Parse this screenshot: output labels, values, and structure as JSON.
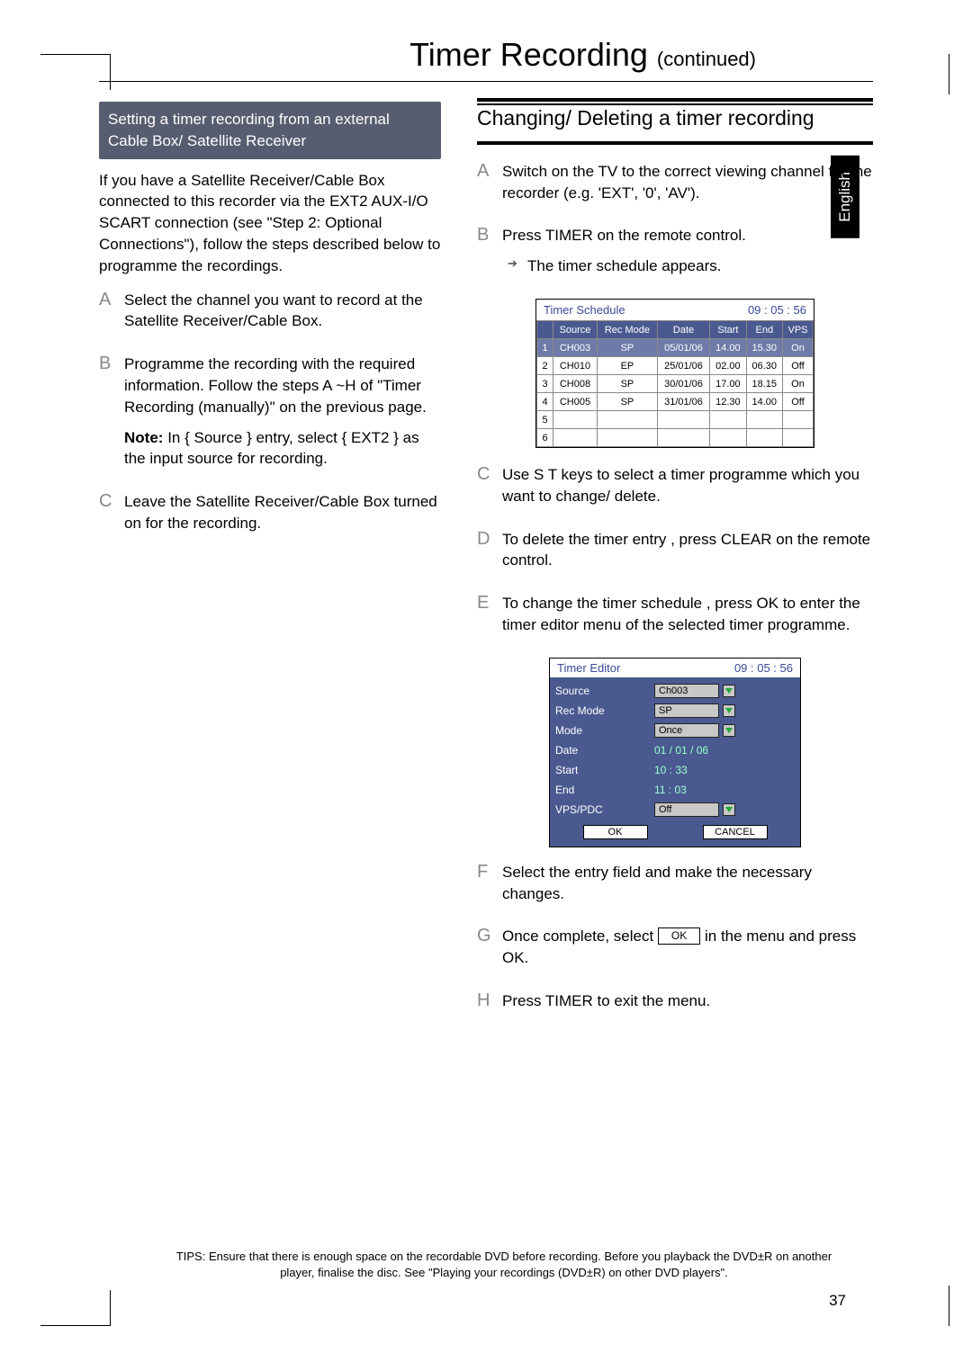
{
  "lang_tab": "English",
  "page_title": "Timer Recording",
  "page_title_cont": "(continued)",
  "page_number": "37",
  "left": {
    "header": "Setting a timer recording from an external Cable Box/ Satellite Receiver",
    "intro": "If you have a Satellite Receiver/Cable Box connected to this recorder via the EXT2 AUX-I/O SCART connection (see \"Step 2: Optional Connections\"), follow the steps described below to programme the recordings.",
    "A": "Select the channel you want to record at the Satellite Receiver/Cable Box.",
    "B": "Programme the recording with the required information. Follow the steps A ~H of \"Timer Recording (manually)\" on the previous page.",
    "B_note_label": "Note:",
    "B_note": "In { Source } entry, select { EXT2 } as the input source for recording.",
    "C": "Leave the Satellite Receiver/Cable Box turned on for the recording."
  },
  "right": {
    "header": "Changing/ Deleting a timer recording",
    "A": "Switch on the TV to the correct viewing channel for the recorder (e.g. 'EXT', '0', 'AV').",
    "B": "Press TIMER on the remote control.",
    "B_sub": "The timer schedule appears.",
    "C": "Use  S T  keys to select a timer programme which you want to change/ delete.",
    "D": "To delete the timer entry  , press CLEAR on the remote control.",
    "E": "To change the timer schedule  , press OK to enter the timer editor menu of the selected timer programme.",
    "F": "Select the entry field and make the necessary changes.",
    "G_pre": "Once complete, select ",
    "G_btn": "OK",
    "G_post": " in the menu and press OK.",
    "H": "Press TIMER to exit the menu."
  },
  "schedule": {
    "title": "Timer Schedule",
    "clock": "09 : 05 : 56",
    "headers": [
      "",
      "Source",
      "Rec Mode",
      "Date",
      "Start",
      "End",
      "VPS"
    ],
    "rows": [
      [
        "1",
        "CH003",
        "SP",
        "05/01/06",
        "14.00",
        "15.30",
        "On"
      ],
      [
        "2",
        "CH010",
        "EP",
        "25/01/06",
        "02.00",
        "06.30",
        "Off"
      ],
      [
        "3",
        "CH008",
        "SP",
        "30/01/06",
        "17.00",
        "18.15",
        "On"
      ],
      [
        "4",
        "CH005",
        "SP",
        "31/01/06",
        "12.30",
        "14.00",
        "Off"
      ],
      [
        "5",
        "",
        "",
        "",
        "",
        "",
        ""
      ],
      [
        "6",
        "",
        "",
        "",
        "",
        "",
        ""
      ]
    ]
  },
  "editor": {
    "title": "Timer Editor",
    "clock": "09 : 05 : 56",
    "source_l": "Source",
    "source_v": "Ch003",
    "recmode_l": "Rec Mode",
    "recmode_v": "SP",
    "mode_l": "Mode",
    "mode_v": "Once",
    "date_l": "Date",
    "date_v": "01 / 01 / 06",
    "start_l": "Start",
    "start_v": "10 : 33",
    "end_l": "End",
    "end_v": "11 : 03",
    "vps_l": "VPS/PDC",
    "vps_v": "Off",
    "ok": "OK",
    "cancel": "CANCEL"
  },
  "tips": "TIPS: Ensure that there is enough space on the recordable DVD before recording. Before you playback the DVD±R on another player, finalise the disc. See \"Playing your recordings (DVD±R) on other DVD players\"."
}
